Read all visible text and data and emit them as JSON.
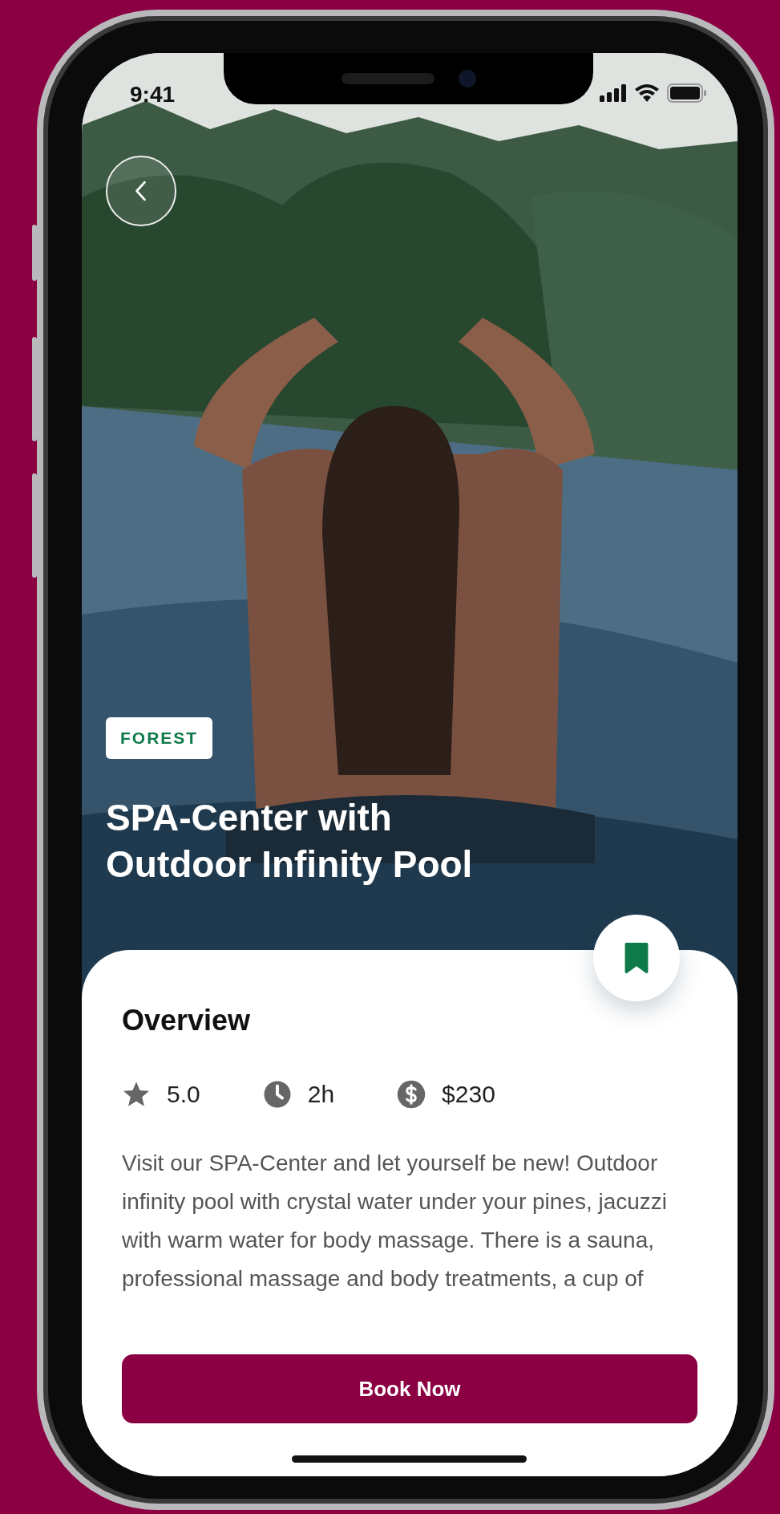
{
  "status_bar": {
    "time": "9:41"
  },
  "hero": {
    "tag": "FOREST",
    "title": "SPA-Center with Outdoor Infinity Pool"
  },
  "bookmark": {
    "saved": true
  },
  "overview": {
    "heading": "Overview",
    "stats": [
      {
        "kind": "rating",
        "value": "5.0"
      },
      {
        "kind": "duration",
        "value": "2h"
      },
      {
        "kind": "price",
        "value": "$230"
      }
    ],
    "description": "Visit our SPA-Center and let yourself be new! Outdoor infinity pool with crystal water under your pines, jacuzzi with warm water for body massage. There is a sauna, professional massage and body treatments, a cup of"
  },
  "primary_action": "Book Now"
}
